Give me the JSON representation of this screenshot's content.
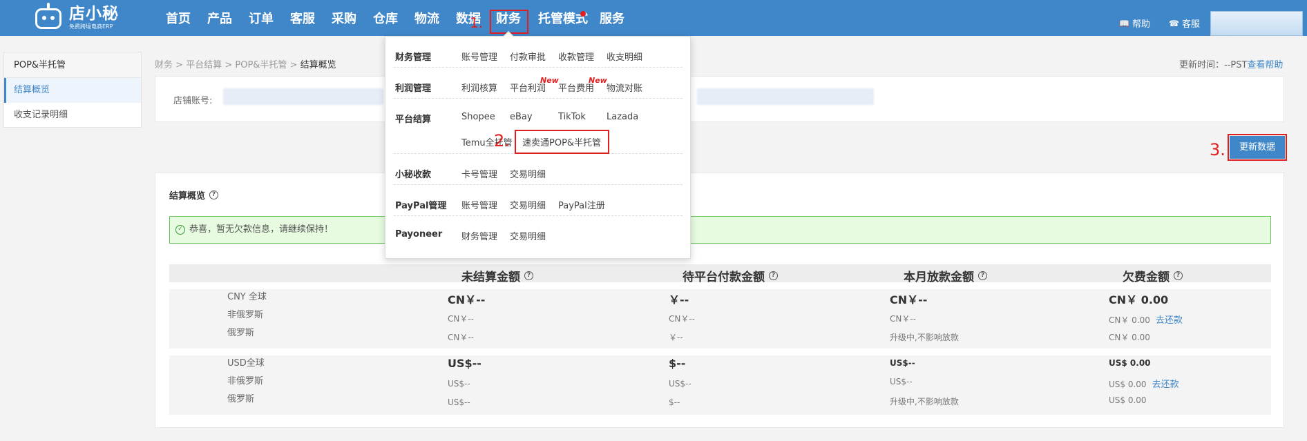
{
  "brand": {
    "name": "店小秘",
    "slogan": "免费跨境电商ERP"
  },
  "nav": {
    "items": [
      "首页",
      "产品",
      "订单",
      "客服",
      "采购",
      "仓库",
      "物流",
      "数据",
      "财务",
      "托管模式",
      "服务"
    ],
    "help": "帮助",
    "service": "客服"
  },
  "annotations": {
    "step1": "1.",
    "step2": "2.",
    "step3": "3."
  },
  "sidebar": {
    "title": "POP&半托管",
    "items": [
      "结算概览",
      "收支记录明细"
    ]
  },
  "breadcrumb": {
    "items": [
      "财务",
      "平台结算",
      "POP&半托管"
    ],
    "current": "结算概览"
  },
  "update": {
    "label": "更新时间：--PST",
    "help_link": "查看帮助",
    "button": "更新数据"
  },
  "filter": {
    "shop_label": "店铺账号:"
  },
  "overview": {
    "title": "结算概览",
    "notice": "恭喜，暂无欠款信息，请继续保持！",
    "columns": [
      "未结算金额",
      "待平台付款金额",
      "本月放款金额",
      "欠费金额"
    ],
    "repay_link": "去还款",
    "groups": [
      {
        "labels": [
          "CNY 全球",
          "非俄罗斯",
          "俄罗斯"
        ],
        "cells": [
          [
            "CN￥--",
            "CN￥--",
            "CN￥--"
          ],
          [
            "￥--",
            "CN￥--",
            "￥--"
          ],
          [
            "CN￥--",
            "CN￥--",
            "升级中,不影响放款"
          ],
          [
            "CN￥ 0.00",
            "CN￥ 0.00",
            "CN￥ 0.00"
          ]
        ]
      },
      {
        "labels": [
          "USD全球",
          "非俄罗斯",
          "俄罗斯"
        ],
        "cells": [
          [
            "US$--",
            "US$--",
            "US$--"
          ],
          [
            "$--",
            "US$--",
            "$--"
          ],
          [
            "US$--",
            "US$--",
            "升级中,不影响放款"
          ],
          [
            "US$ 0.00",
            "US$ 0.00",
            "US$ 0.00"
          ]
        ]
      }
    ]
  },
  "menu": {
    "new_tag": "New",
    "rows": [
      {
        "category": "财务管理",
        "links": [
          "账号管理",
          "付款审批",
          "收款管理",
          "收支明细"
        ]
      },
      {
        "category": "利润管理",
        "links": [
          "利润核算",
          "平台利润",
          "平台费用",
          "物流对账"
        ]
      },
      {
        "category": "平台结算",
        "links": [
          "Shopee",
          "eBay",
          "TikTok",
          "Lazada",
          "Temu全托管",
          "速卖通POP&半托管"
        ]
      },
      {
        "category": "小秘收款",
        "links": [
          "卡号管理",
          "交易明细"
        ]
      },
      {
        "category": "PayPal管理",
        "links": [
          "账号管理",
          "交易明细",
          "PayPal注册"
        ]
      },
      {
        "category": "Payoneer",
        "links": [
          "财务管理",
          "交易明细"
        ]
      }
    ]
  },
  "colors": {
    "primary": "#3f87c9",
    "annotation": "#e02020",
    "notice_bg": "#e6fbe0"
  }
}
